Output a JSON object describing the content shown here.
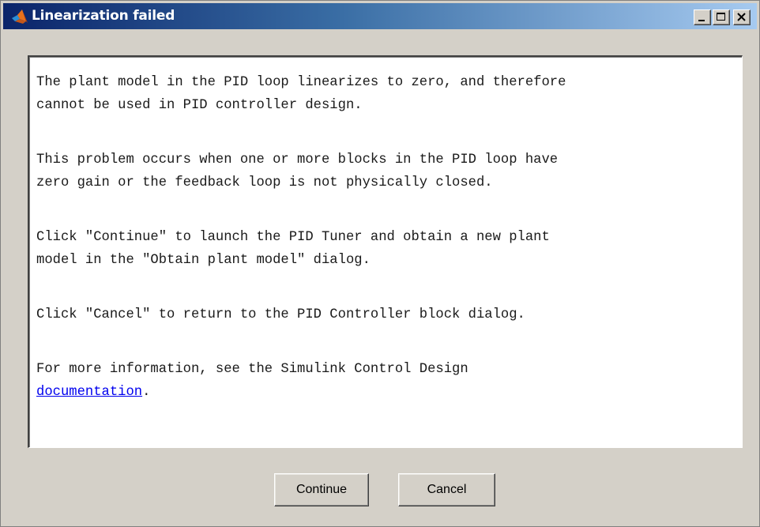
{
  "window": {
    "title": "Linearization failed",
    "icon": "matlab-logo-icon",
    "controls": [
      "minimize-icon",
      "maximize-icon",
      "close-icon"
    ]
  },
  "message": {
    "p1_line1": "The plant model in the PID loop linearizes to zero, and therefore",
    "p1_line2": "cannot be used in PID controller design.",
    "p2_line1": "This problem occurs when one or more blocks in the PID loop have",
    "p2_line2": "zero gain or the feedback loop is not physically closed.",
    "p3_line1": "Click \"Continue\" to launch the PID Tuner and obtain a new plant",
    "p3_line2": "model in the \"Obtain plant model\" dialog.",
    "p4_line1": "Click \"Cancel\" to return to the PID Controller block dialog.",
    "p5_line1": "For more information, see the Simulink Control Design",
    "p5_link": "documentation",
    "p5_after_link": "."
  },
  "buttons": {
    "continue_label": "Continue",
    "cancel_label": "Cancel"
  },
  "colors": {
    "titlebar_start": "#0a246a",
    "titlebar_end": "#a6caf0",
    "dialog_bg": "#d4d0c8",
    "link": "#0000ee"
  }
}
